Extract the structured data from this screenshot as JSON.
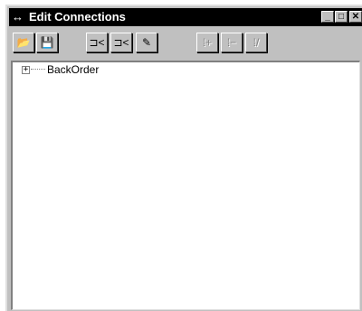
{
  "window": {
    "title": "Edit Connections",
    "title_icon": "↔",
    "caption_buttons": {
      "minimize": "_",
      "maximize": "□",
      "close": "✕"
    }
  },
  "toolbar": {
    "buttons": [
      {
        "name": "open-folder-icon",
        "glyph": "📂",
        "enabled": true
      },
      {
        "name": "save-icon",
        "glyph": "💾",
        "enabled": true
      },
      {
        "name": "connect-icon",
        "glyph": "⊐<",
        "enabled": true
      },
      {
        "name": "disconnect-icon",
        "glyph": "⊐<",
        "enabled": true
      },
      {
        "name": "edit-connection-icon",
        "glyph": "✎",
        "enabled": true
      },
      {
        "name": "add-item-icon",
        "glyph": "⁞+",
        "enabled": false
      },
      {
        "name": "remove-item-icon",
        "glyph": "⁞−",
        "enabled": false
      },
      {
        "name": "edit-item-icon",
        "glyph": "⁞/",
        "enabled": false
      }
    ]
  },
  "tree": {
    "nodes": [
      {
        "label": "BackOrder",
        "expander": "+"
      }
    ]
  },
  "colors": {
    "titlebar": "#000000",
    "face": "#c0c0c0",
    "workspace": "#ffffff"
  }
}
